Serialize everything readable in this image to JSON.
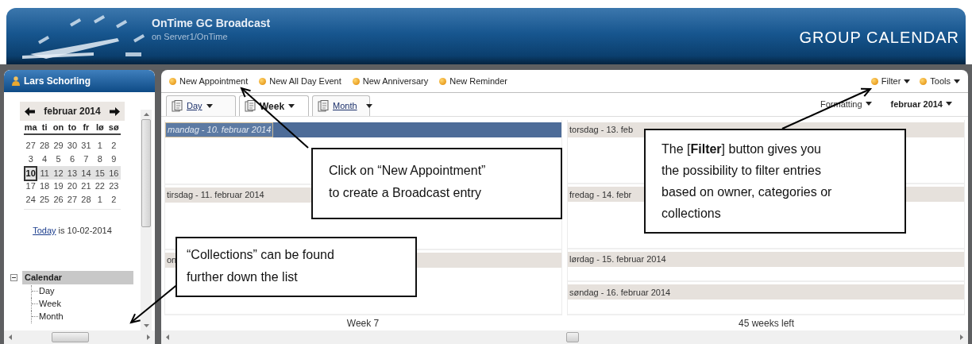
{
  "header": {
    "title": "OnTime GC Broadcast",
    "subtitle": "on Server1/OnTime",
    "logo": "GROUP CALENDAR"
  },
  "sidebar": {
    "user": "Lars Schorling",
    "month_label": "februar 2014",
    "weekdays": [
      "ma",
      "ti",
      "on",
      "to",
      "fr",
      "lø",
      "sø"
    ],
    "weeks": [
      {
        "selected": false,
        "days": [
          {
            "label": "27",
            "today": false
          },
          {
            "label": "28",
            "today": false
          },
          {
            "label": "29",
            "today": false
          },
          {
            "label": "30",
            "today": false
          },
          {
            "label": "31",
            "today": false
          },
          {
            "label": "1",
            "today": false
          },
          {
            "label": "2",
            "today": false
          }
        ]
      },
      {
        "selected": false,
        "days": [
          {
            "label": "3",
            "today": false
          },
          {
            "label": "4",
            "today": false
          },
          {
            "label": "5",
            "today": false
          },
          {
            "label": "6",
            "today": false
          },
          {
            "label": "7",
            "today": false
          },
          {
            "label": "8",
            "today": false
          },
          {
            "label": "9",
            "today": false
          }
        ]
      },
      {
        "selected": true,
        "days": [
          {
            "label": "10",
            "today": true
          },
          {
            "label": "11",
            "today": false
          },
          {
            "label": "12",
            "today": false
          },
          {
            "label": "13",
            "today": false
          },
          {
            "label": "14",
            "today": false
          },
          {
            "label": "15",
            "today": false
          },
          {
            "label": "16",
            "today": false
          }
        ]
      },
      {
        "selected": false,
        "days": [
          {
            "label": "17",
            "today": false
          },
          {
            "label": "18",
            "today": false
          },
          {
            "label": "19",
            "today": false
          },
          {
            "label": "20",
            "today": false
          },
          {
            "label": "21",
            "today": false
          },
          {
            "label": "22",
            "today": false
          },
          {
            "label": "23",
            "today": false
          }
        ]
      },
      {
        "selected": false,
        "days": [
          {
            "label": "24",
            "today": false
          },
          {
            "label": "25",
            "today": false
          },
          {
            "label": "26",
            "today": false
          },
          {
            "label": "27",
            "today": false
          },
          {
            "label": "28",
            "today": false
          },
          {
            "label": "1",
            "today": false
          },
          {
            "label": "2",
            "today": false
          }
        ]
      }
    ],
    "today_link": "Today",
    "today_text": "is 10-02-2014",
    "tree": [
      {
        "label": "Calendar",
        "expanded": true,
        "selected": true,
        "children": [
          {
            "label": "Day"
          },
          {
            "label": "Week"
          },
          {
            "label": "Month"
          }
        ]
      }
    ]
  },
  "toolbar": {
    "left": [
      {
        "label": "New Appointment",
        "menu": false
      },
      {
        "label": "New All Day Event",
        "menu": false
      },
      {
        "label": "New Anniversary",
        "menu": false
      },
      {
        "label": "New Reminder",
        "menu": false
      }
    ],
    "right": [
      {
        "label": "Filter",
        "menu": true
      },
      {
        "label": "Tools",
        "menu": true
      }
    ]
  },
  "tabs": [
    {
      "label": "Day",
      "selected": false
    },
    {
      "label": "Week",
      "selected": true
    },
    {
      "label": "Month",
      "selected": false
    }
  ],
  "formatting": "Formatting",
  "period": "februar 2014",
  "columns": [
    {
      "days": [
        {
          "label": "mandag - 10. februar 2014",
          "selected": true
        },
        {
          "label": "tirsdag - 11. februar 2014",
          "selected": false
        },
        {
          "label": "on",
          "selected": false
        }
      ]
    },
    {
      "days": [
        {
          "label": "torsdag - 13. feb",
          "selected": false
        },
        {
          "label": "fredag - 14. febr",
          "selected": false
        },
        {
          "label": "lørdag - 15. februar 2014",
          "selected": false
        },
        {
          "label": "søndag - 16. februar 2014",
          "selected": false
        }
      ]
    }
  ],
  "footer": {
    "week": "Week 7",
    "weeks_left": "45 weeks left"
  },
  "callouts": [
    {
      "lines": [
        "Click on “New  Appointment”",
        "to create a Broadcast entry"
      ]
    },
    {
      "lines": [
        "“Collections” can be found",
        "further down the list"
      ]
    },
    {
      "lines": [
        "The [**Filter**] button gives you",
        "the possibility to filter entries",
        "based on owner, categories or",
        "collections"
      ]
    }
  ]
}
